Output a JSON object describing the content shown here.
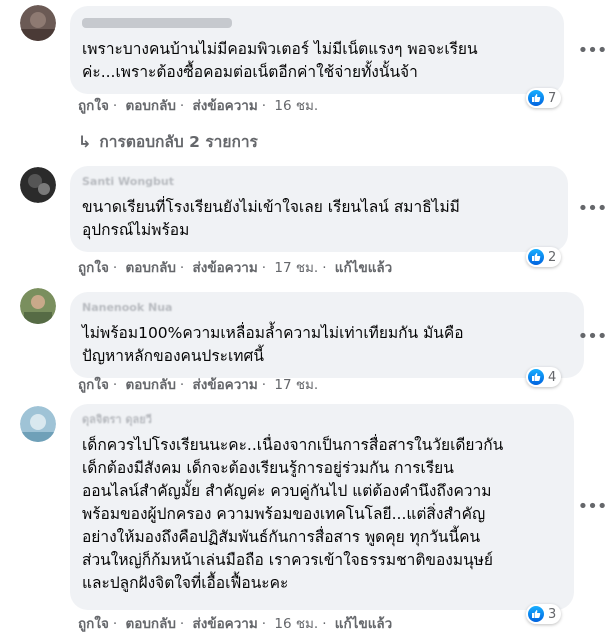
{
  "icon_color_like": "#1877f2",
  "comments": [
    {
      "author": "",
      "text": "เพราะบางคนบ้านไม่มีคอมพิวเตอร์ ไม่มีเน็ตแรงๆ พอจะเรียน\nค่ะ...เพราะต้องซื้อคอมต่อเน็ตอีกค่าใช้จ่ายทั้งนั้นจ้า",
      "like": "ถูกใจ",
      "reply": "ตอบกลับ",
      "message": "ส่งข้อความ",
      "time": "16 ชม.",
      "reactions": "7"
    },
    {
      "author": "Santi Wongbut",
      "text": "ขนาดเรียนที่โรงเรียนยังไม่เข้าใจเลย เรียนไลน์ สมาธิไม่มี\nอุปกรณ์ไม่พร้อม",
      "like": "ถูกใจ",
      "reply": "ตอบกลับ",
      "message": "ส่งข้อความ",
      "time": "17 ชม.",
      "edited": "แก้ไขแล้ว",
      "reactions": "2"
    },
    {
      "author": "Nanenook Nua",
      "text": "ไม่พร้อม100%ความเหลื่อมล้ำความไม่เท่าเทียมกัน มันคือ\nปัญหาหลักของคนประเทศนี้",
      "like": "ถูกใจ",
      "reply": "ตอบกลับ",
      "message": "ส่งข้อความ",
      "time": "17 ชม.",
      "reactions": "4"
    },
    {
      "author": "ดุลจิตรา ดุลยวี",
      "text": "เด็กควรไปโรงเรียนนะคะ..เนื่องจากเป็นการสื่อสารในวัยเดียวกัน\nเด็กต้องมีสังคม เด็กจะต้องเรียนรู้การอยู่ร่วมกัน การเรียน\nออนไลน์สำคัญมั้ย สำคัญค่ะ ควบคู่กันไป แต่ต้องคำนึงถึงความ\nพร้อมของผู้ปกครอง ความพร้อมของเทคโนโลยี...แต่สิ่งสำคัญ\nอย่างให้มองถึงคือปฏิสัมพันธ์กันการสื่อสาร พูดคุย ทุกวันนี้คน\nส่วนใหญ่ก็ก้มหน้าเล่นมือถือ เราควรเข้าใจธรรมชาติของมนุษย์\nและปลูกฝังจิตใจที่เอื้อเฟื้อนะคะ",
      "like": "ถูกใจ",
      "reply": "ตอบกลับ",
      "message": "ส่งข้อความ",
      "time": "16 ชม.",
      "edited": "แก้ไขแล้ว",
      "reactions": "3"
    }
  ],
  "replies_link": "การตอบกลับ 2 รายการ"
}
